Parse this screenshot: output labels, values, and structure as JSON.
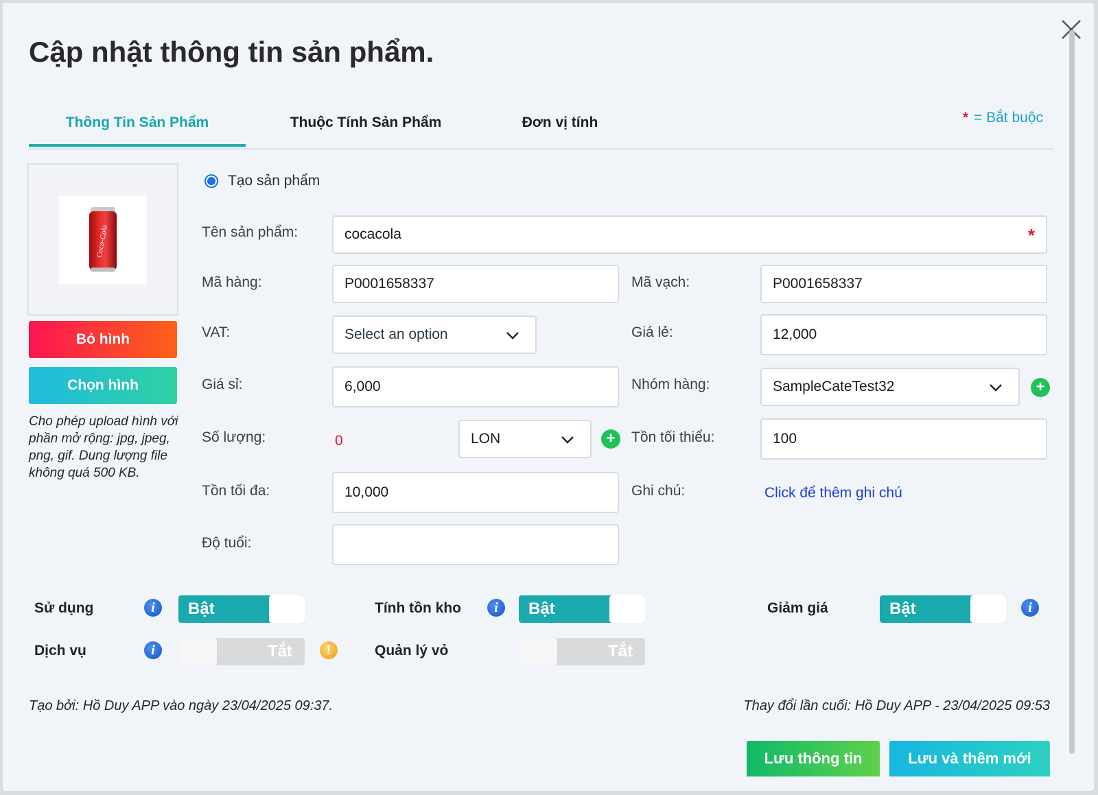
{
  "modal": {
    "title": "Cập nhật thông tin sản phẩm.",
    "tabs": [
      {
        "label": "Thông Tin Sản Phẩm"
      },
      {
        "label": "Thuộc Tính Sản Phẩm"
      },
      {
        "label": "Đơn vị tính"
      }
    ],
    "required_note": "= Bắt buộc",
    "required_star": "*"
  },
  "image_panel": {
    "remove_label": "Bỏ hình",
    "choose_label": "Chọn hình",
    "upload_note": "Cho phép upload hình với phần mở rộng: jpg, jpeg, png, gif. Dung lượng file không quá 500 KB.",
    "can_logo_text": "Coca-Cola"
  },
  "form": {
    "mode_label": "Tạo sản phẩm",
    "name": {
      "label": "Tên sản phẩm:",
      "value": "cocacola",
      "required": "*"
    },
    "sku": {
      "label": "Mã hàng:",
      "value": "P0001658337"
    },
    "barcode": {
      "label": "Mã vạch:",
      "value": "P0001658337"
    },
    "vat": {
      "label": "VAT:",
      "value": "Select an option"
    },
    "retail_price": {
      "label": "Giá lẻ:",
      "value": "12,000"
    },
    "wholesale_price": {
      "label": "Giá sỉ:",
      "value": "6,000"
    },
    "category": {
      "label": "Nhóm hàng:",
      "value": "SampleCateTest32"
    },
    "quantity": {
      "label": "Số lượng:",
      "value": "0",
      "unit": "LON"
    },
    "min_stock": {
      "label": "Tồn tối thiểu:",
      "value": "100"
    },
    "max_stock": {
      "label": "Tồn tối đa:",
      "value": "10,000"
    },
    "note": {
      "label": "Ghi chú:",
      "link": "Click để thêm ghi chú"
    },
    "age": {
      "label": "Độ tuổi:",
      "value": ""
    }
  },
  "toggles": {
    "use": {
      "label": "Sử dụng",
      "state": "Bật"
    },
    "inventory": {
      "label": "Tính tồn kho",
      "state": "Bật"
    },
    "discount": {
      "label": "Giảm giá",
      "state": "Bật"
    },
    "service": {
      "label": "Dịch vụ",
      "state": "Tắt"
    },
    "shell": {
      "label": "Quản lý vỏ",
      "state": "Tắt"
    }
  },
  "footer": {
    "created": "Tạo bởi: Hồ Duy APP vào ngày 23/04/2025 09:37.",
    "modified": "Thay đổi lần cuối: Hồ Duy APP - 23/04/2025 09:53",
    "save_label": "Lưu thông tin",
    "save_new_label": "Lưu và thêm mới"
  },
  "colors": {
    "accent": "#1fb0b3",
    "required": "#e8173c",
    "link": "#1c3fd6",
    "add": "#21c15a"
  }
}
